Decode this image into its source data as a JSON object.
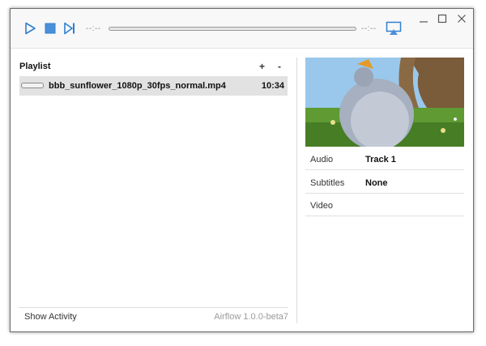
{
  "toolbar": {
    "time_elapsed": "--:--",
    "time_remaining": "--:--",
    "seek_progress": 0.0,
    "accent_color": "#4a90d9"
  },
  "window_controls": {
    "icons": [
      "minimize-icon",
      "maximize-icon",
      "close-icon"
    ]
  },
  "playlist": {
    "title": "Playlist",
    "add_label": "+",
    "remove_label": "-",
    "items": [
      {
        "name": "bbb_sunflower_1080p_30fps_normal.mp4",
        "duration": "10:34",
        "progress": 0.0
      }
    ]
  },
  "footer": {
    "show_activity": "Show Activity",
    "version": "Airflow 1.0.0-beta7"
  },
  "media_info": {
    "rows": [
      {
        "key": "Audio",
        "value": "Track 1"
      },
      {
        "key": "Subtitles",
        "value": "None"
      },
      {
        "key": "Video",
        "value": ""
      }
    ]
  }
}
